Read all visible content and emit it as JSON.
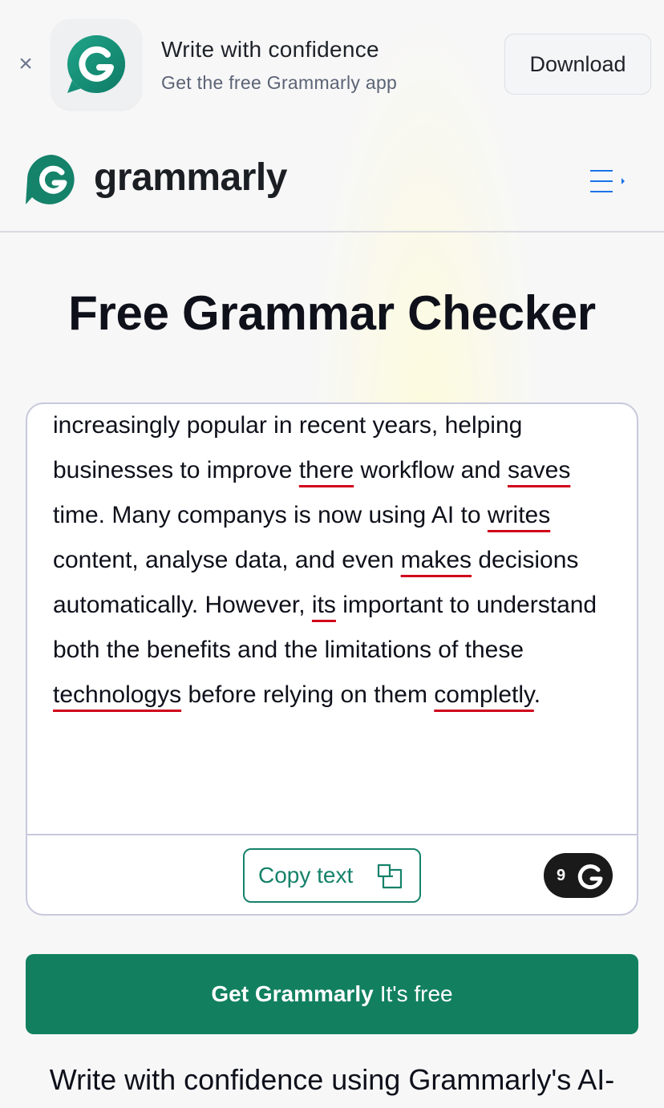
{
  "app_banner": {
    "close_glyph": "×",
    "title": "Write with confidence",
    "subtitle": "Get the free Grammarly app",
    "download_label": "Download",
    "icon": "grammarly-g-icon"
  },
  "header": {
    "logo_text": "grammarly",
    "menu_icon": "hamburger-menu-icon"
  },
  "page_title": "Free Grammar Checker",
  "editor": {
    "segments": [
      {
        "text": "increasingly popular in recent years, helping businesses to improve ",
        "error": false
      },
      {
        "text": "there",
        "error": true
      },
      {
        "text": " workflow and ",
        "error": false
      },
      {
        "text": "saves",
        "error": true
      },
      {
        "text": " time. Many companys is now using AI to ",
        "error": false
      },
      {
        "text": "writes",
        "error": true
      },
      {
        "text": " content, analyse data, and even ",
        "error": false
      },
      {
        "text": "makes",
        "error": true
      },
      {
        "text": " decisions automatically. However, ",
        "error": false
      },
      {
        "text": "its",
        "error": true
      },
      {
        "text": " important to understand both the benefits and the limitations of these ",
        "error": false
      },
      {
        "text": "technologys",
        "error": true
      },
      {
        "text": " before relying on them ",
        "error": false
      },
      {
        "text": "completly",
        "error": true
      },
      {
        "text": ".",
        "error": false
      }
    ],
    "copy_label": "Copy text",
    "suggestion_count": "9"
  },
  "cta": {
    "strong": "Get Grammarly",
    "rest": "It's free"
  },
  "tagline": "Write with confidence using Grammarly's AI-",
  "colors": {
    "brand_green": "#15826a",
    "cta_green": "#12805f",
    "error_red": "#d0021b",
    "menu_blue": "#1a73e8"
  }
}
